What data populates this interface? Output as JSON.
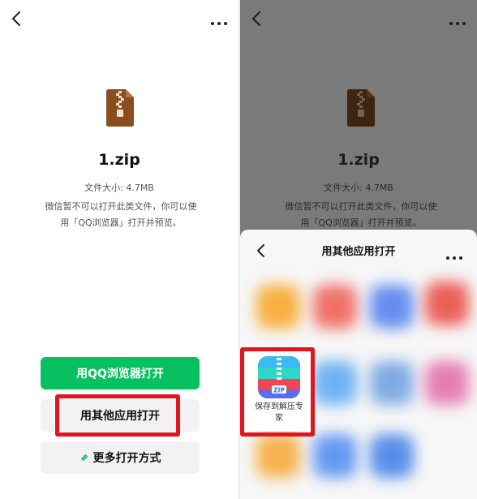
{
  "file": {
    "name": "1.zip",
    "size_label": "文件大小: 4.7MB",
    "hint_line1": "微信暂不可以打开此类文件，你可以使",
    "hint_line2": "用「QQ浏览器」打开并预览。"
  },
  "actions": {
    "open_qq_browser": "用QQ浏览器打开",
    "open_other_app": "用其他应用打开",
    "more_open_methods": "更多打开方式"
  },
  "sheet": {
    "title": "用其他应用打开",
    "app": {
      "label_line1": "保存到解压专",
      "label_line2": "家",
      "icon_text": "ZIP"
    }
  },
  "colors": {
    "primary_green": "#07c160",
    "highlight_red": "#e2151f",
    "zip_icon_brown": "#8a4e1e"
  },
  "icons": {
    "back": "chevron-left-icon",
    "more": "more-dots-icon",
    "file": "zip-file-icon",
    "link": "link-icon"
  }
}
